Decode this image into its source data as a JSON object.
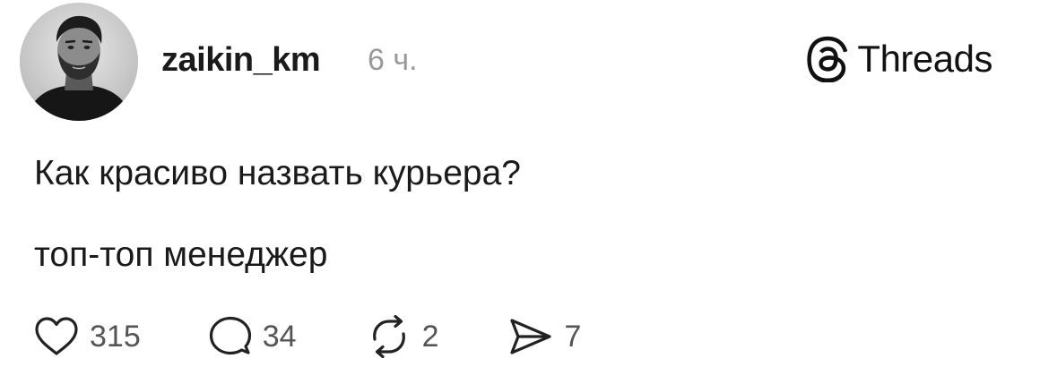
{
  "post": {
    "username": "zaikin_km",
    "time": "6 ч.",
    "brand": "Threads",
    "text_line1": "Как красиво назвать курьера?",
    "text_line2": "топ-топ менеджер"
  },
  "actions": {
    "likes": "315",
    "comments": "34",
    "reposts": "2",
    "shares": "7"
  },
  "icons": {
    "avatar": "avatar-photo",
    "brand": "threads-logo-icon",
    "like": "heart-icon",
    "comment": "comment-bubble-icon",
    "repost": "repost-icon",
    "share": "send-icon"
  },
  "colors": {
    "text": "#1a1a1a",
    "muted": "#9a9a9a",
    "counts": "#555555"
  }
}
